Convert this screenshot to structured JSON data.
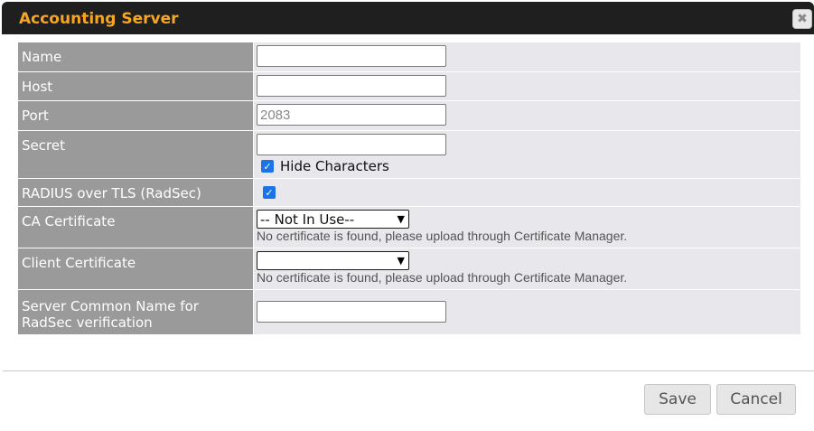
{
  "dialog": {
    "title": "Accounting Server",
    "close_glyph": "✖"
  },
  "form": {
    "name": {
      "label": "Name",
      "value": ""
    },
    "host": {
      "label": "Host",
      "value": ""
    },
    "port": {
      "label": "Port",
      "value": "",
      "placeholder": "2083"
    },
    "secret": {
      "label": "Secret",
      "value": "",
      "hide_characters_label": "Hide Characters",
      "hide_characters_checked": true
    },
    "radsec": {
      "label": "RADIUS over TLS (RadSec)",
      "checked": true
    },
    "ca_certificate": {
      "label": "CA Certificate",
      "selected": "-- Not In Use--",
      "hint": "No certificate is found, please upload through Certificate Manager."
    },
    "client_certificate": {
      "label": "Client Certificate",
      "selected": "",
      "hint": "No certificate is found, please upload through Certificate Manager."
    },
    "server_common_name": {
      "label_line1": "Server Common Name for",
      "label_line2": "RadSec verification",
      "value": ""
    }
  },
  "footer": {
    "save_label": "Save",
    "cancel_label": "Cancel"
  },
  "colors": {
    "title": "#f5a623",
    "titlebar": "#1f1f1f",
    "label_bg": "#9a9a9a",
    "value_bg": "#e7e7ec",
    "checkbox": "#1a73e8"
  }
}
